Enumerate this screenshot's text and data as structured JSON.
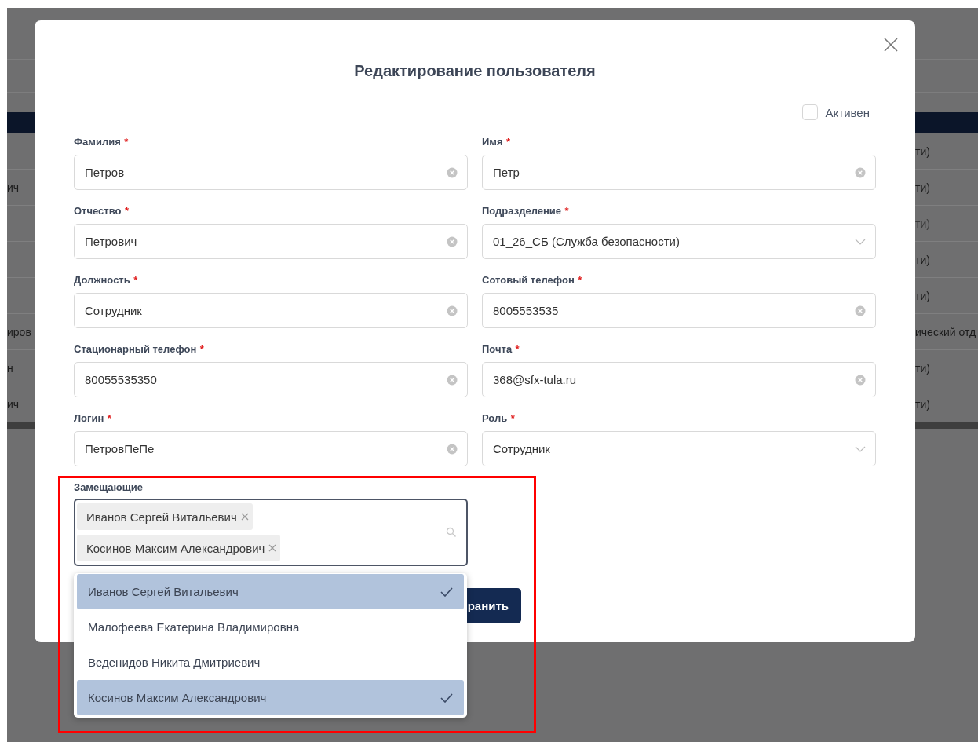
{
  "background_table": {
    "rows": [
      {
        "column_2": "ти)",
        "dimmed": false
      },
      {
        "column_1": "ич",
        "column_2": "ти)",
        "dimmed": false
      },
      {
        "column_2": "ти)",
        "dimmed": true
      },
      {
        "column_2": "ти)",
        "dimmed": false
      },
      {
        "column_2": "ти)",
        "dimmed": false
      },
      {
        "column_1": "иров",
        "column_2": "ический отд",
        "dimmed": false
      },
      {
        "column_1": "н",
        "column_2": "ти)",
        "dimmed": false
      },
      {
        "column_1": "ич",
        "column_2": "ти)",
        "dimmed": false
      }
    ]
  },
  "dialog": {
    "title": "Редактирование пользователя",
    "active": {
      "label": "Активен",
      "checked": false
    },
    "fields": [
      {
        "label": "Фамилия",
        "required_mark": "*",
        "kind": "text",
        "value": "Петров"
      },
      {
        "label": "Имя",
        "required_mark": "*",
        "kind": "text",
        "value": "Петр"
      },
      {
        "label": "Отчество",
        "required_mark": "*",
        "kind": "text",
        "value": "Петрович"
      },
      {
        "label": "Подразделение",
        "required_mark": "*",
        "kind": "select",
        "value": "01_26_СБ (Служба безопасности)"
      },
      {
        "label": "Должность",
        "required_mark": "*",
        "kind": "text",
        "value": "Сотрудник"
      },
      {
        "label": "Сотовый телефон",
        "required_mark": "*",
        "kind": "text",
        "value": "8005553535"
      },
      {
        "label": "Стационарный телефон",
        "required_mark": "*",
        "kind": "text",
        "value": "80055535350"
      },
      {
        "label": "Почта",
        "required_mark": "*",
        "kind": "text",
        "value": "368@sfx-tula.ru"
      },
      {
        "label": "Логин",
        "required_mark": "*",
        "kind": "text",
        "value": "ПетровПеПе"
      },
      {
        "label": "Роль",
        "required_mark": "*",
        "kind": "select",
        "value": "Сотрудник"
      }
    ],
    "substitutes": {
      "label": "Замещающие",
      "tags": [
        "Иванов Сергей Витальевич",
        "Косинов Максим Александрович"
      ],
      "options": [
        {
          "label": "Иванов Сергей Витальевич",
          "selected": true
        },
        {
          "label": "Малофеева Екатерина Владимировна",
          "selected": false
        },
        {
          "label": "Веденидов Никита Дмитриевич",
          "selected": false
        },
        {
          "label": "Косинов Максим Александрович",
          "selected": true
        }
      ]
    },
    "save_button": {
      "label": "ранить"
    }
  },
  "highlight_frame": true
}
